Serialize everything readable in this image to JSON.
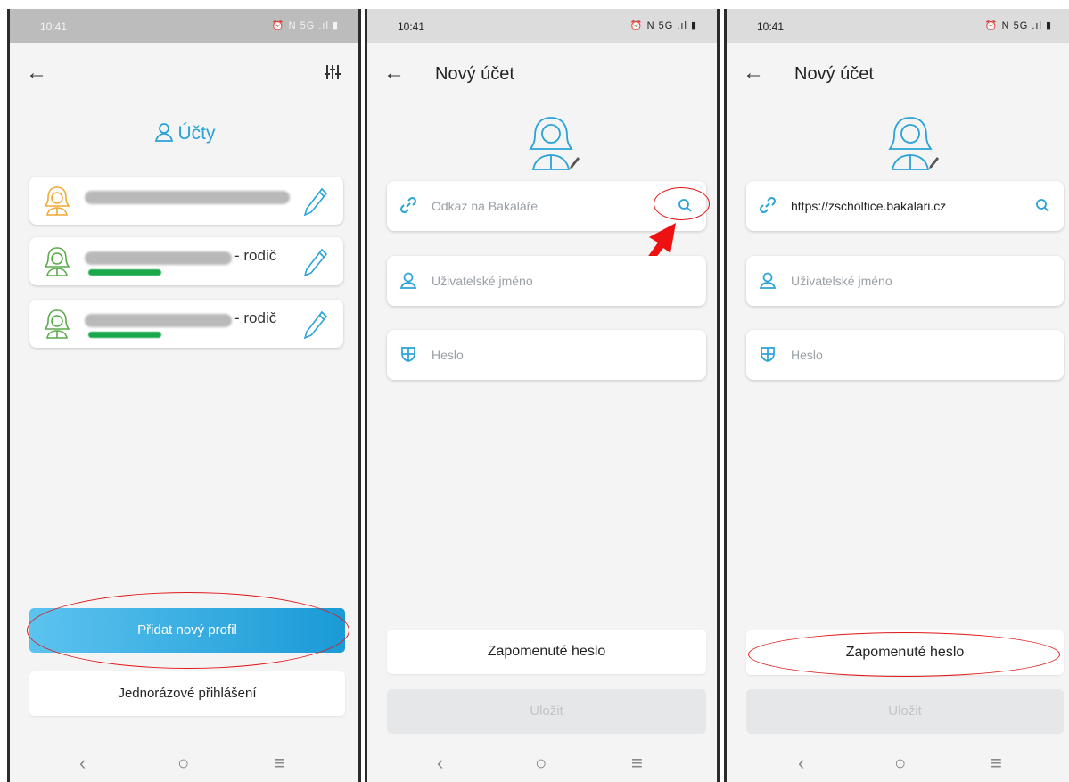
{
  "colors": {
    "accent": "#29a3d8",
    "annotation": "#e01818",
    "success": "#1ba84a"
  },
  "screen1": {
    "status_time": "10:41",
    "status_icons": "⏰ N 5G .ıl ▮",
    "back_icon": "arrow-left",
    "filter_icon": "sliders",
    "heading": "Účty",
    "accounts": [
      {
        "role": ""
      },
      {
        "role": "- rodič"
      },
      {
        "role": "- rodič"
      }
    ],
    "add_profile_label": "Přidat nový profil",
    "one_time_login_label": "Jednorázové přihlášení"
  },
  "screen2": {
    "status_time": "10:41",
    "status_icons": "⏰ N 5G .ıl ▮",
    "title": "Nový účet",
    "url_placeholder": "Odkaz na Bakaláře",
    "username_placeholder": "Uživatelské jméno",
    "password_placeholder": "Heslo",
    "forgot_label": "Zapomenuté heslo",
    "save_label": "Uložit"
  },
  "screen3": {
    "status_time": "10:41",
    "status_icons": "⏰ N 5G .ıl ▮",
    "title": "Nový účet",
    "url_value": "https://zscholtice.bakalari.cz",
    "username_placeholder": "Uživatelské jméno",
    "password_placeholder": "Heslo",
    "forgot_label": "Zapomenuté heslo",
    "save_label": "Uložit"
  },
  "navbar": {
    "back": "‹",
    "home": "○",
    "menu": "≡"
  }
}
